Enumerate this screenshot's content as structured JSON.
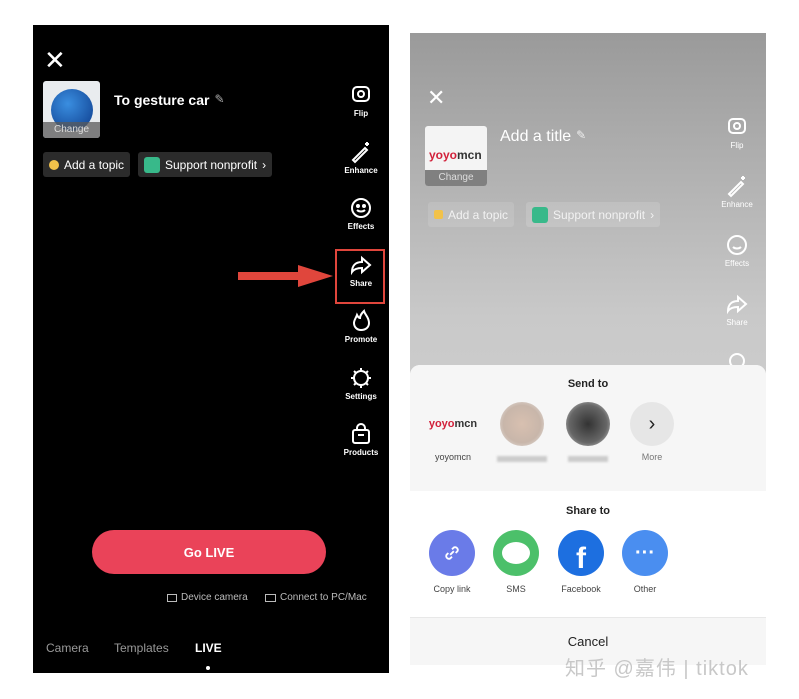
{
  "left": {
    "close_icon": "close-icon",
    "thumbnail_change": "Change",
    "title": "To gesture car",
    "chips": [
      {
        "label": "Add a topic"
      },
      {
        "label": "Support nonprofit"
      }
    ],
    "tools": [
      {
        "label": "Flip",
        "icon": "flip-camera-icon"
      },
      {
        "label": "Enhance",
        "icon": "magic-wand-icon"
      },
      {
        "label": "Effects",
        "icon": "smile-icon"
      },
      {
        "label": "Share",
        "icon": "share-arrow-icon"
      },
      {
        "label": "Promote",
        "icon": "flame-icon"
      },
      {
        "label": "Settings",
        "icon": "gear-icon"
      },
      {
        "label": "Products",
        "icon": "shopping-bag-icon"
      }
    ],
    "go_live": "Go LIVE",
    "device_camera": "Device camera",
    "connect_pc": "Connect to PC/Mac",
    "tabs": [
      {
        "label": "Camera"
      },
      {
        "label": "Templates"
      },
      {
        "label": "LIVE",
        "active": true
      }
    ]
  },
  "annotation": {
    "color": "#e0463c"
  },
  "right": {
    "thumbnail_logo": "yoyomcn",
    "thumbnail_change": "Change",
    "title": "Add a title",
    "chips": [
      {
        "label": "Add a topic"
      },
      {
        "label": "Support nonprofit"
      }
    ],
    "tools": [
      {
        "label": "Flip"
      },
      {
        "label": "Enhance"
      },
      {
        "label": "Effects"
      },
      {
        "label": "Share"
      }
    ],
    "sheet": {
      "send_to": "Send to",
      "contacts": [
        {
          "label": "yoyomcn",
          "logo": "yoyomcn"
        },
        {
          "label": ""
        },
        {
          "label": ""
        },
        {
          "label": "More"
        }
      ],
      "share_to": "Share to",
      "targets": [
        {
          "label": "Copy link",
          "color": "#6a7be8"
        },
        {
          "label": "SMS",
          "color": "#4cc06a"
        },
        {
          "label": "Facebook",
          "color": "#1d6fe0"
        },
        {
          "label": "Other",
          "color": "#4a8ef0"
        }
      ],
      "cancel": "Cancel"
    }
  },
  "watermark": "知乎 @嘉伟 | tiktok"
}
